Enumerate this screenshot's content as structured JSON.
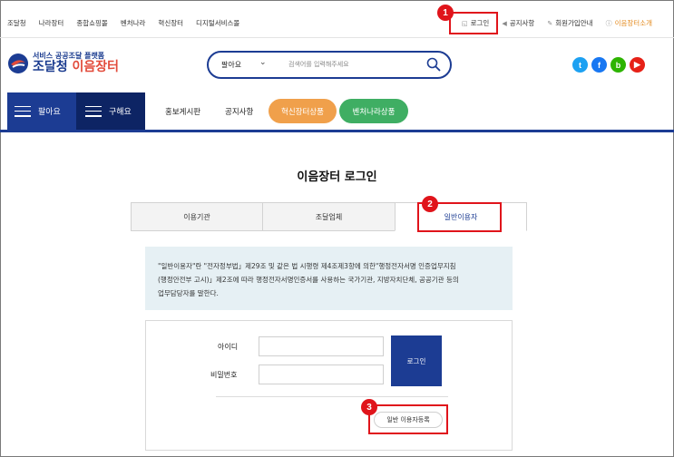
{
  "topbar": {
    "links": [
      "조달청",
      "나라장터",
      "종합쇼핑몰",
      "벤처나라",
      "혁신장터",
      "디지털서비스몰"
    ],
    "login": "로그인",
    "notice": "공지사항",
    "signup": "회원가입안내",
    "about": "이음장터소개"
  },
  "header": {
    "logo_sub": "서비스 공공조달 플랫폼",
    "logo_main_a": "조달청",
    "logo_main_b": "이음장터",
    "search_select": "팔아요",
    "search_placeholder": "검색어를 입력해주세요",
    "social_icons": [
      "twitter-icon",
      "facebook-icon",
      "blog-icon",
      "youtube-icon"
    ]
  },
  "nav": {
    "sell": "팔아요",
    "buy": "구해요",
    "promo": "홍보게시판",
    "notice": "공지사항",
    "innovation": "혁신장터상품",
    "venture": "벤처나라상품"
  },
  "login": {
    "title": "이음장터 로그인",
    "tabs": [
      "이용기관",
      "조달업체",
      "일반이용자"
    ],
    "active_tab": "일반이용자",
    "info_lines": [
      "\"일반이용자\"란 \"전자정부법」제29조 및 같은 법 시행령 제4조제3항에 의한\"행정전자서명 인증업무지침",
      "(행정안전부 고시)」제2조에 따라 행정전자서명인증서를 사용하는 국가기관, 지방자치단체, 공공기관 등의",
      "업무담당자를 말한다."
    ],
    "id_label": "아이디",
    "pw_label": "비밀번호",
    "login_button": "로그인",
    "register_button": "일반 이용자등록"
  },
  "annotations": {
    "badges": [
      "1",
      "2",
      "3"
    ],
    "highlight_color": "#e0141b"
  },
  "colors": {
    "brand_navy": "#1c3c93",
    "innovation_pill": "#f0a04b",
    "venture_pill": "#3fae63",
    "info_bg": "#e6f0f4"
  }
}
